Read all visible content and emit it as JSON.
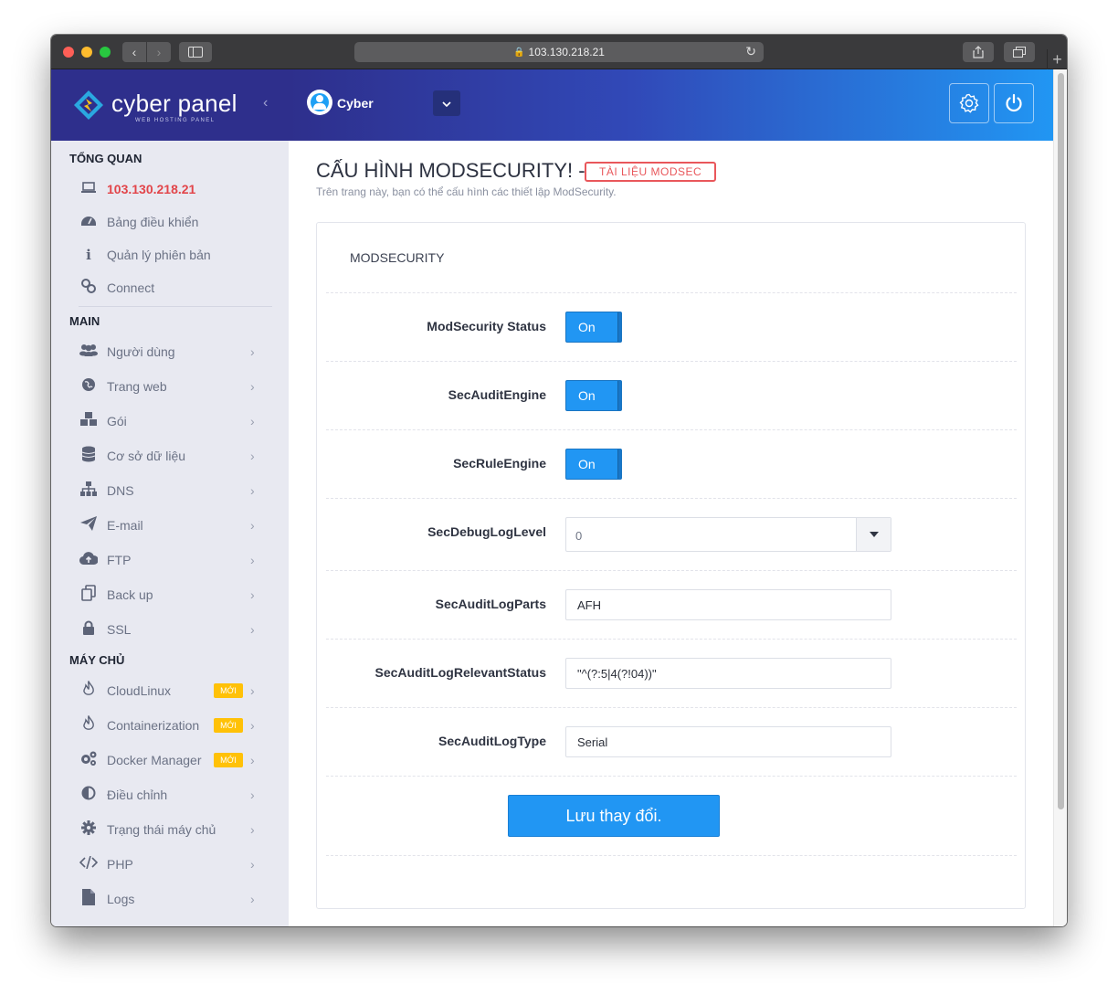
{
  "browser": {
    "address": "103.130.218.21"
  },
  "brand": {
    "name": "cyber panel",
    "tagline": "WEB HOSTING PANEL"
  },
  "header": {
    "user_name": "Cyber"
  },
  "sidebar": {
    "sections": [
      {
        "title": "TỔNG QUAN"
      },
      {
        "title": "MAIN"
      },
      {
        "title": "MÁY CHỦ"
      }
    ],
    "overview_items": [
      {
        "label": "103.130.218.21",
        "icon": "laptop-icon"
      },
      {
        "label": "Bảng điều khiển",
        "icon": "dashboard-icon"
      },
      {
        "label": "Quản lý phiên bản",
        "icon": "info-icon"
      },
      {
        "label": "Connect",
        "icon": "link-icon"
      }
    ],
    "main_items": [
      {
        "label": "Người dùng",
        "icon": "users-icon"
      },
      {
        "label": "Trang web",
        "icon": "globe-icon"
      },
      {
        "label": "Gói",
        "icon": "cubes-icon"
      },
      {
        "label": "Cơ sở dữ liệu",
        "icon": "database-icon"
      },
      {
        "label": "DNS",
        "icon": "sitemap-icon"
      },
      {
        "label": "E-mail",
        "icon": "paper-plane-icon"
      },
      {
        "label": "FTP",
        "icon": "cloud-upload-icon"
      },
      {
        "label": "Back up",
        "icon": "copy-icon"
      },
      {
        "label": "SSL",
        "icon": "lock-icon"
      }
    ],
    "server_items": [
      {
        "label": "CloudLinux",
        "icon": "fire-icon",
        "badge": "MỚI"
      },
      {
        "label": "Containerization",
        "icon": "fire-icon",
        "badge": "MỚI"
      },
      {
        "label": "Docker Manager",
        "icon": "cogs-icon",
        "badge": "MỚI"
      },
      {
        "label": "Điều chỉnh",
        "icon": "adjust-icon"
      },
      {
        "label": "Trạng thái máy chủ",
        "icon": "gear-icon"
      },
      {
        "label": "PHP",
        "icon": "code-icon"
      },
      {
        "label": "Logs",
        "icon": "file-icon"
      }
    ]
  },
  "page": {
    "title": "CẤU HÌNH MODSECURITY! -",
    "doc_link": "TÀI LIỆU MODSEC",
    "subtitle": "Trên trang này, bạn có thể cấu hình các thiết lập ModSecurity."
  },
  "panel": {
    "title": "MODSECURITY",
    "toggles": [
      {
        "label": "ModSecurity Status",
        "value": "On"
      },
      {
        "label": "SecAuditEngine",
        "value": "On"
      },
      {
        "label": "SecRuleEngine",
        "value": "On"
      }
    ],
    "debug_log_level": {
      "label": "SecDebugLogLevel",
      "value": "0"
    },
    "audit_log_parts": {
      "label": "SecAuditLogParts",
      "value": "AFH"
    },
    "audit_log_relevant_status": {
      "label": "SecAuditLogRelevantStatus",
      "value": "\"^(?:5|4(?!04))\""
    },
    "audit_log_type": {
      "label": "SecAuditLogType",
      "value": "Serial"
    },
    "save_label": "Lưu thay đổi."
  },
  "colors": {
    "primary": "#2196f3",
    "sidebar_bg": "#e8e9f1",
    "header_dark": "#2e2f8c",
    "danger": "#e9575b",
    "badge": "#ffc107"
  }
}
